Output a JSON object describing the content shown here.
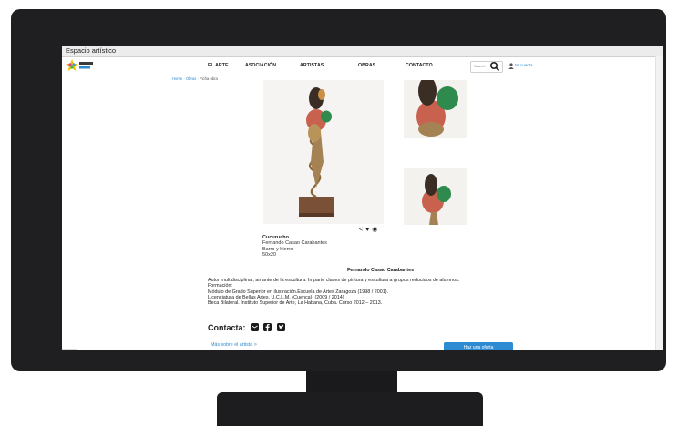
{
  "window": {
    "title": "Espacio artístico"
  },
  "nav": {
    "items": [
      "EL ARTE",
      "ASOCIACIÓN",
      "ARTISTAS",
      "OBRAS",
      "CONTACTO"
    ]
  },
  "search": {
    "placeholder": "Search"
  },
  "account": {
    "label": "Mi cuenta"
  },
  "breadcrumb": {
    "home": "Home",
    "obras": "Obras",
    "current": "Ficha obra"
  },
  "obra": {
    "title": "Cucurucho",
    "artist": "Fernando Casao Carabantes",
    "material": "Barro y hierro",
    "size": "50x20"
  },
  "artist": {
    "name": "Fernando Casao Carabantes",
    "bio": [
      "Autor multidisciplinar, amante de la escultura. Imparte clases de pintura y escultura a grupos reducidos de alumnos.",
      "Formación:",
      "Módulo de Grado Superior en ilustración.Escuela de Artes Zaragoza (1998 / 2001).",
      "Licenciatura de Bellas Artes. U.C.L.M. (Cuenca). (2009 / 2014)",
      "Beca Bilateral. Instituto Superior de Arte, La Habana, Cuba. Curso 2012 – 2013."
    ]
  },
  "contact": {
    "label": "Contacta:"
  },
  "links": {
    "more_artist": "Más sobre el artista >",
    "offer": "Haz una oferta"
  },
  "colors": {
    "accent": "#2e8bd1",
    "monitor": "#1f1f21"
  }
}
